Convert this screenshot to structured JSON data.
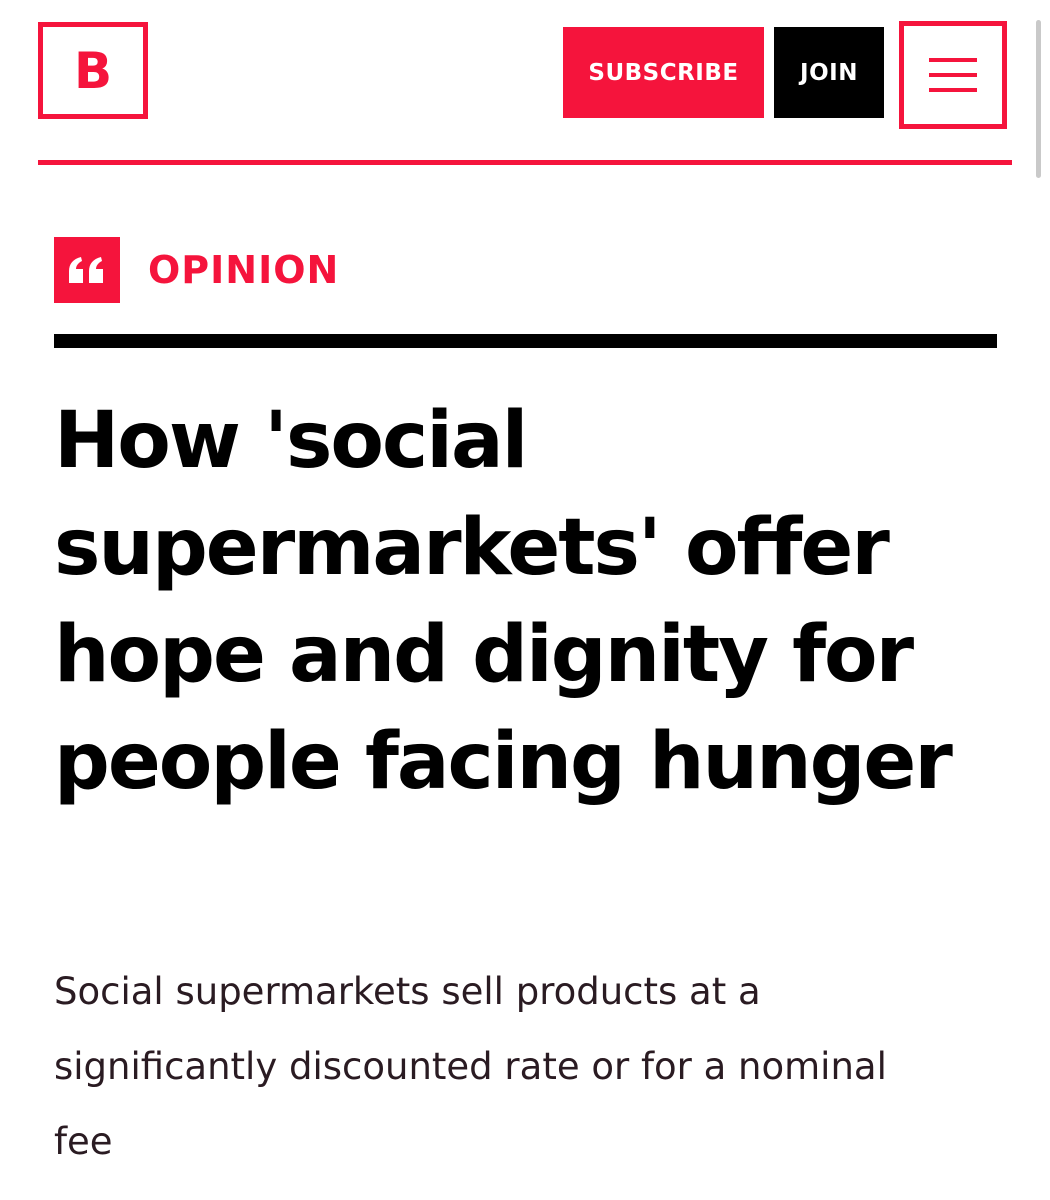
{
  "header": {
    "logo_letter": "B",
    "subscribe_label": "SUBSCRIBE",
    "join_label": "JOIN",
    "menu_icon": "hamburger-menu-icon"
  },
  "article": {
    "section_icon": "quote-icon",
    "section_label": "OPINION",
    "headline": "How 'social supermarkets' offer hope and dignity for people facing hunger",
    "standfirst": "Social supermarkets sell products at a significantly discounted rate or for a nominal fee"
  },
  "colors": {
    "brand_red": "#f5143c",
    "black": "#000000",
    "body_text": "#2a1b22"
  }
}
